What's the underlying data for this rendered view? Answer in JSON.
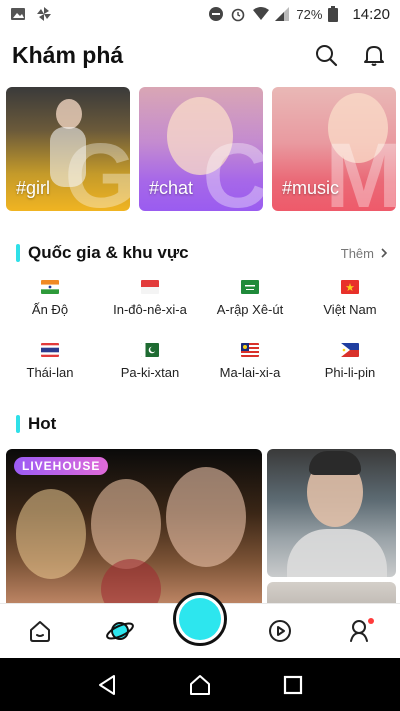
{
  "status_bar": {
    "battery_percent": "72%",
    "time": "14:20",
    "icons": [
      "image-icon",
      "pinwheel-icon",
      "do-not-disturb-icon",
      "alarm-icon",
      "wifi-icon",
      "signal-icon",
      "battery-icon"
    ]
  },
  "header": {
    "title": "Khám phá",
    "icons": [
      "search-icon",
      "bell-icon"
    ]
  },
  "topics": [
    {
      "label": "#girl",
      "big_letter": "G",
      "color": "#f0b422"
    },
    {
      "label": "#chat",
      "big_letter": "C",
      "color": "#9a5cf0"
    },
    {
      "label": "#music",
      "big_letter": "M",
      "color": "#ee5a6a"
    }
  ],
  "countries_section": {
    "title": "Quốc gia & khu vực",
    "more_label": "Thêm",
    "accent_color": "#2fe0e8",
    "items": [
      {
        "name": "Ấn Độ",
        "flag": "india-flag"
      },
      {
        "name": "In-đô-nê-xi-a",
        "flag": "indonesia-flag"
      },
      {
        "name": "A-rập Xê-út",
        "flag": "saudi-flag"
      },
      {
        "name": "Việt Nam",
        "flag": "vietnam-flag"
      },
      {
        "name": "Thái-lan",
        "flag": "thailand-flag"
      },
      {
        "name": "Pa-ki-xtan",
        "flag": "pakistan-flag"
      },
      {
        "name": "Ma-lai-xi-a",
        "flag": "malaysia-flag"
      },
      {
        "name": "Phi-li-pin",
        "flag": "philippines-flag"
      }
    ]
  },
  "hot_section": {
    "title": "Hot",
    "live_badge": "LIVEHOUSE"
  },
  "bottom_nav": {
    "items": [
      "home-icon",
      "planet-icon",
      "record-button",
      "video-icon",
      "profile-icon"
    ],
    "record_color": "#2de6ee"
  },
  "system_nav": [
    "back-icon",
    "home-circle-icon",
    "recents-icon"
  ]
}
